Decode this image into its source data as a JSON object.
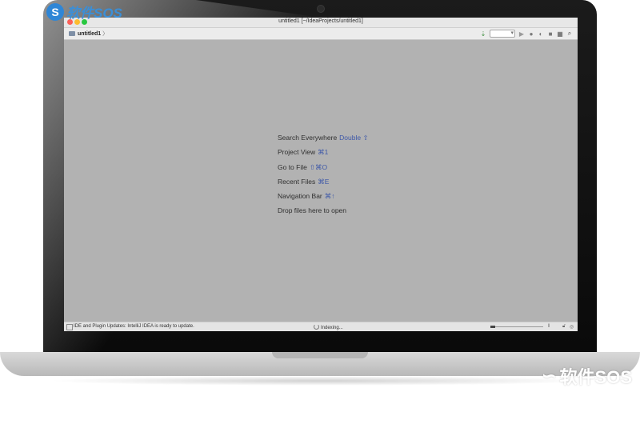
{
  "watermark": {
    "brand": "软件SOS",
    "brand_bottom": "软件SOS"
  },
  "window": {
    "title": "untitled1 [~/IdeaProjects/untitled1]"
  },
  "toolbar": {
    "breadcrumb": "untitled1",
    "breadcrumb_chevron": "〉"
  },
  "hints": [
    {
      "label": "Search Everywhere",
      "shortcut": "Double ⇧"
    },
    {
      "label": "Project View",
      "shortcut": "⌘1"
    },
    {
      "label": "Go to File",
      "shortcut": "⇧⌘O"
    },
    {
      "label": "Recent Files",
      "shortcut": "⌘E"
    },
    {
      "label": "Navigation Bar",
      "shortcut": "⌘↑"
    },
    {
      "label": "Drop files here to open",
      "shortcut": ""
    }
  ],
  "status": {
    "message": "IDE and Plugin Updates: IntelliJ IDEA is ready to update.",
    "indexing": "Indexing..."
  },
  "colors": {
    "shortcut": "#3e58a8",
    "editor_bg": "#b2b2b2"
  }
}
